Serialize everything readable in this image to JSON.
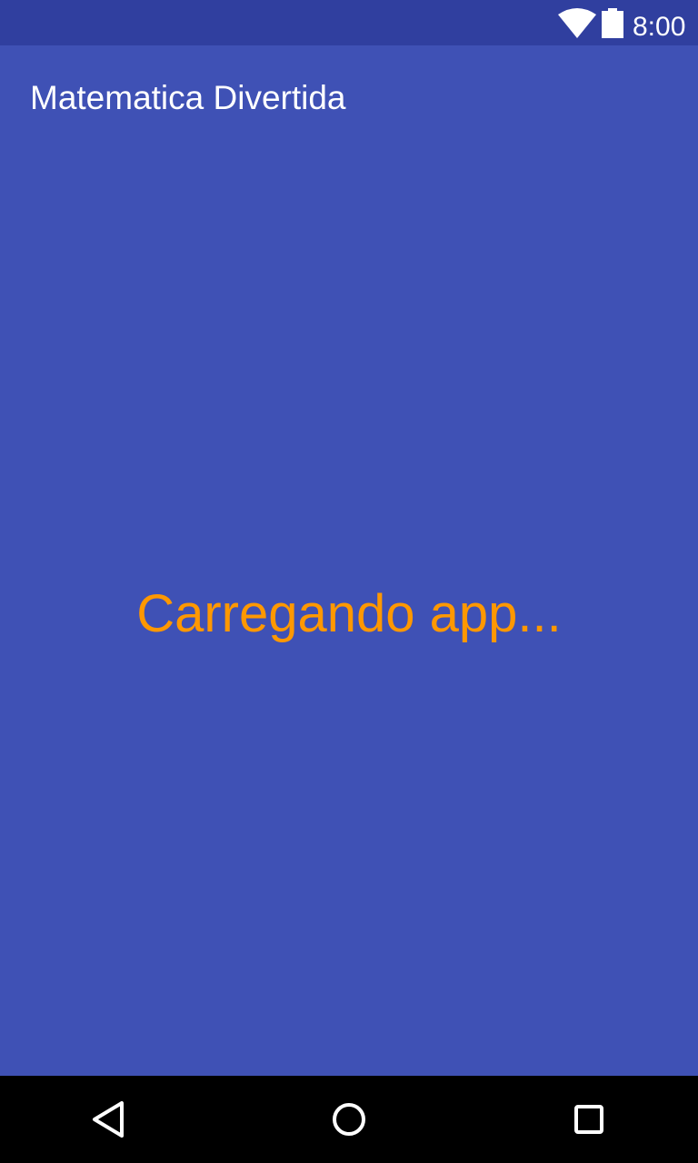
{
  "status_bar": {
    "time": "8:00",
    "icons": [
      "wifi-icon",
      "battery-icon"
    ]
  },
  "app_bar": {
    "title": "Matematica Divertida"
  },
  "main": {
    "loading_text": "Carregando app..."
  },
  "nav_bar": {
    "buttons": [
      "back-icon",
      "home-icon",
      "recents-icon"
    ]
  },
  "colors": {
    "primary": "#3F51B5",
    "primary_dark": "#303F9F",
    "accent_text": "#FF9800",
    "nav_background": "#000000"
  }
}
